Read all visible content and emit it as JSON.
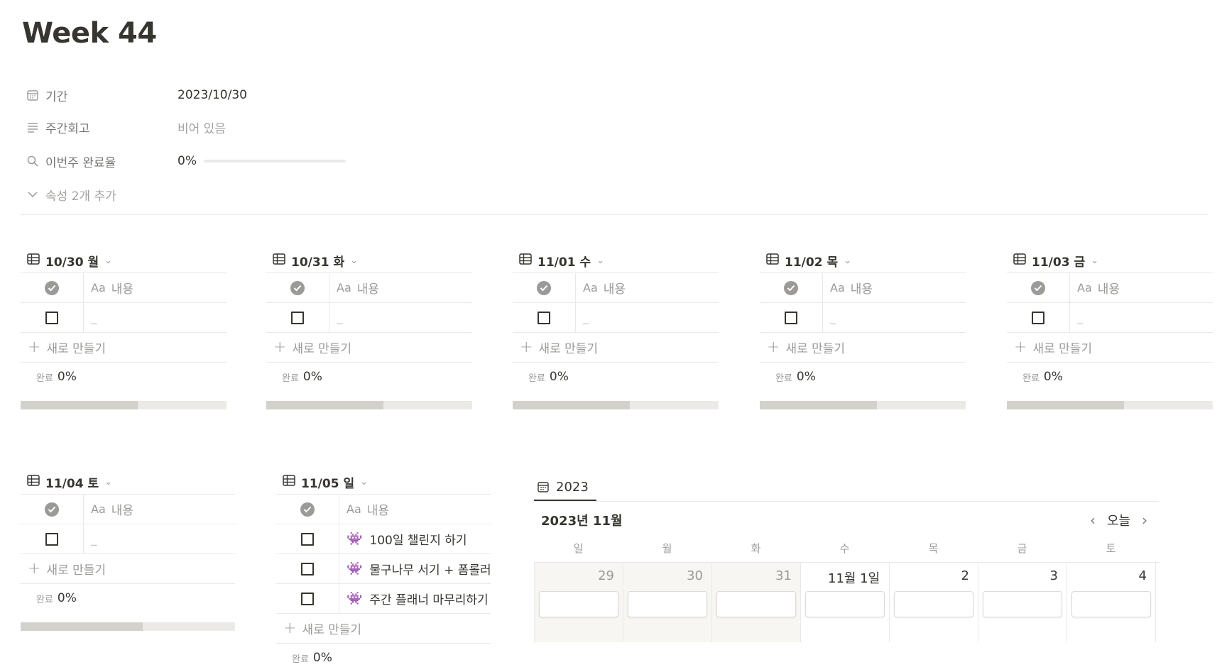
{
  "page": {
    "title": "Week 44",
    "properties": [
      {
        "icon": "calendar-icon",
        "name": "기간",
        "value": "2023/10/30"
      },
      {
        "icon": "text-lines-icon",
        "name": "주간회고",
        "value": "비어 있음"
      },
      {
        "icon": "search-icon",
        "name": "이번주 완료율",
        "value": "0%",
        "progress": 0
      }
    ],
    "more_props": "속성 2개 추가"
  },
  "table_labels": {
    "content_header": "내용",
    "aa": "Aa",
    "empty_cell": "_",
    "new_row": "새로 만들기",
    "summary_label": "완료",
    "summary_value": "0%"
  },
  "boards": [
    {
      "title": "10/30 월",
      "items": []
    },
    {
      "title": "10/31 화",
      "items": []
    },
    {
      "title": "11/01 수",
      "items": []
    },
    {
      "title": "11/02 목",
      "items": []
    },
    {
      "title": "11/03 금",
      "items": []
    },
    {
      "title": "11/04 토",
      "items": []
    },
    {
      "title": "11/05 일",
      "items": [
        {
          "icon": "space-invader-icon",
          "text": "100일 챌린지 하기"
        },
        {
          "icon": "space-invader-icon",
          "text": "물구나무 서기 + 폼롤러"
        },
        {
          "icon": "space-invader-icon",
          "text": "주간 플래너 마무리하기"
        }
      ]
    }
  ],
  "calendar": {
    "tab": "2023",
    "month": "2023년 11월",
    "today": "오늘",
    "weekdays": [
      "일",
      "월",
      "화",
      "수",
      "목",
      "금",
      "토"
    ],
    "days": [
      "29",
      "30",
      "31",
      "11월 1일",
      "2",
      "3",
      "4"
    ]
  },
  "colors": {
    "text": "#37352f",
    "muted": "#9b9a97",
    "border": "#e9e9e7",
    "bar_fill": "#d3d1cb",
    "bar_track": "#ebeae7"
  }
}
